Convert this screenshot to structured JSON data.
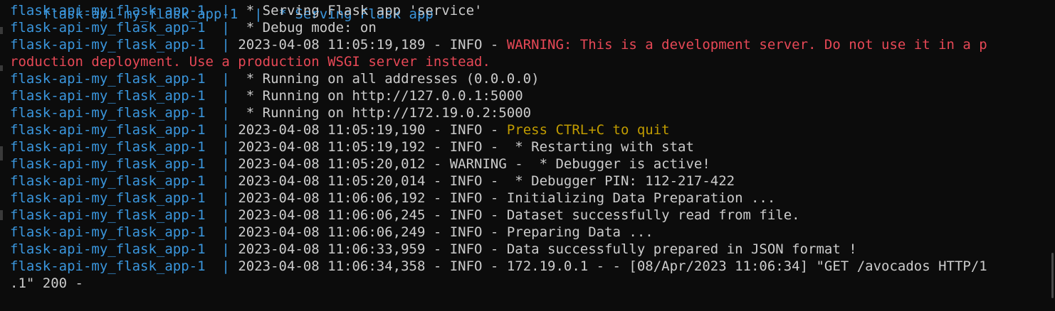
{
  "terminal": {
    "clipped_top": "flask-api-my_flask_app-1  |  * Serving Flask app",
    "lines": [
      {
        "container": "flask-api-my_flask_app-1",
        "sep": "  |  ",
        "prefix": "",
        "message": "* Serving Flask app 'service'",
        "color": "default"
      },
      {
        "container": "flask-api-my_flask_app-1",
        "sep": "  |  ",
        "prefix": "",
        "message": "* Debug mode: on",
        "color": "default"
      },
      {
        "container": "flask-api-my_flask_app-1",
        "sep": "  | ",
        "prefix": "2023-04-08 11:05:19,189 - INFO - ",
        "message": "WARNING: This is a development server. Do not use it in a p",
        "color": "red"
      },
      {
        "container": "",
        "sep": "",
        "prefix": "",
        "message": "roduction deployment. Use a production WSGI server instead.",
        "color": "red"
      },
      {
        "container": "flask-api-my_flask_app-1",
        "sep": "  |  ",
        "prefix": "",
        "message": "* Running on all addresses (0.0.0.0)",
        "color": "default"
      },
      {
        "container": "flask-api-my_flask_app-1",
        "sep": "  |  ",
        "prefix": "",
        "message": "* Running on http://127.0.0.1:5000",
        "color": "default"
      },
      {
        "container": "flask-api-my_flask_app-1",
        "sep": "  |  ",
        "prefix": "",
        "message": "* Running on http://172.19.0.2:5000",
        "color": "default"
      },
      {
        "container": "flask-api-my_flask_app-1",
        "sep": "  | ",
        "prefix": "2023-04-08 11:05:19,190 - INFO - ",
        "message": "Press CTRL+C to quit",
        "color": "yellow"
      },
      {
        "container": "flask-api-my_flask_app-1",
        "sep": "  | ",
        "prefix": "2023-04-08 11:05:19,192 - INFO - ",
        "message": " * Restarting with stat",
        "color": "default"
      },
      {
        "container": "flask-api-my_flask_app-1",
        "sep": "  | ",
        "prefix": "2023-04-08 11:05:20,012 - WARNING - ",
        "message": " * Debugger is active!",
        "color": "default"
      },
      {
        "container": "flask-api-my_flask_app-1",
        "sep": "  | ",
        "prefix": "2023-04-08 11:05:20,014 - INFO - ",
        "message": " * Debugger PIN: 112-217-422",
        "color": "default"
      },
      {
        "container": "flask-api-my_flask_app-1",
        "sep": "  | ",
        "prefix": "2023-04-08 11:06:06,192 - INFO - ",
        "message": "Initializing Data Preparation ...",
        "color": "default"
      },
      {
        "container": "flask-api-my_flask_app-1",
        "sep": "  | ",
        "prefix": "2023-04-08 11:06:06,245 - INFO - ",
        "message": "Dataset successfully read from file.",
        "color": "default"
      },
      {
        "container": "flask-api-my_flask_app-1",
        "sep": "  | ",
        "prefix": "2023-04-08 11:06:06,249 - INFO - ",
        "message": "Preparing Data ...",
        "color": "default"
      },
      {
        "container": "flask-api-my_flask_app-1",
        "sep": "  | ",
        "prefix": "2023-04-08 11:06:33,959 - INFO - ",
        "message": "Data successfully prepared in JSON format !",
        "color": "default"
      },
      {
        "container": "flask-api-my_flask_app-1",
        "sep": "  | ",
        "prefix": "2023-04-08 11:06:34,358 - INFO - ",
        "message": "172.19.0.1 - - [08/Apr/2023 11:06:34] \"GET /avocados HTTP/1",
        "color": "default"
      },
      {
        "container": "",
        "sep": "",
        "prefix": "",
        "message": ".1\" 200 -",
        "color": "default"
      }
    ]
  },
  "colors": {
    "background": "#0c0c0c",
    "text": "#cccccc",
    "container": "#3a96dd",
    "warning_red": "#e74856",
    "highlight_yellow": "#c19c00"
  }
}
